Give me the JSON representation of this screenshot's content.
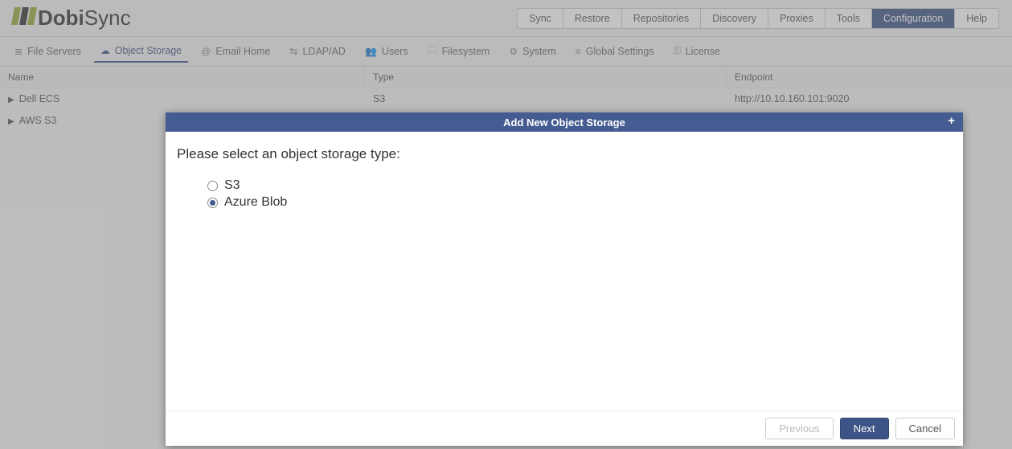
{
  "brand": {
    "name": "Dobi",
    "suffix": "Sync"
  },
  "topnav": {
    "items": [
      {
        "label": "Sync"
      },
      {
        "label": "Restore"
      },
      {
        "label": "Repositories"
      },
      {
        "label": "Discovery"
      },
      {
        "label": "Proxies"
      },
      {
        "label": "Tools"
      },
      {
        "label": "Configuration",
        "active": true
      },
      {
        "label": "Help"
      }
    ]
  },
  "subnav": {
    "items": [
      {
        "icon": "server",
        "label": "File Servers"
      },
      {
        "icon": "cloud",
        "label": "Object Storage",
        "active": true
      },
      {
        "icon": "at",
        "label": "Email Home"
      },
      {
        "icon": "ldap",
        "label": "LDAP/AD"
      },
      {
        "icon": "users",
        "label": "Users"
      },
      {
        "icon": "folder",
        "label": "Filesystem"
      },
      {
        "icon": "gear",
        "label": "System"
      },
      {
        "icon": "sliders",
        "label": "Global Settings"
      },
      {
        "icon": "key",
        "label": "License"
      }
    ]
  },
  "table": {
    "headers": {
      "name": "Name",
      "type": "Type",
      "endpoint": "Endpoint"
    },
    "rows": [
      {
        "name": "Dell ECS",
        "type": "S3",
        "endpoint": "http://10.10.160.101:9020"
      },
      {
        "name": "AWS S3",
        "type": "",
        "endpoint": ""
      }
    ]
  },
  "dialog": {
    "title": "Add New Object Storage",
    "prompt": "Please select an object storage type:",
    "options": [
      {
        "label": "S3",
        "checked": false
      },
      {
        "label": "Azure Blob",
        "checked": true
      }
    ],
    "buttons": {
      "previous": "Previous",
      "next": "Next",
      "cancel": "Cancel"
    }
  },
  "icons": {
    "server": "☰",
    "cloud": "☁",
    "at": "@",
    "ldap": "⇄",
    "users": "👥",
    "folder": "📁",
    "gear": "⚙",
    "sliders": "⚙",
    "key": "⚿"
  }
}
